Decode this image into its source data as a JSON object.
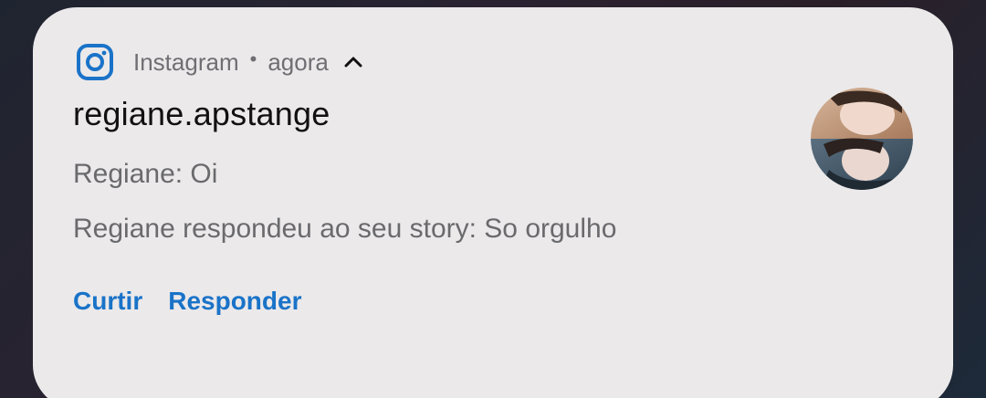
{
  "notification": {
    "app_name": "Instagram",
    "separator": "•",
    "time": "agora",
    "sender": "regiane.apstange",
    "messages": [
      "Regiane: Oi",
      "Regiane respondeu ao seu story: So orgulho"
    ],
    "actions": {
      "like": "Curtir",
      "reply": "Responder"
    }
  },
  "colors": {
    "card_background": "#ebe9ea",
    "action_color": "#1a73c8",
    "app_icon_color": "#1a73c8"
  },
  "icons": {
    "app": "instagram-icon",
    "expand": "chevron-up-icon"
  }
}
